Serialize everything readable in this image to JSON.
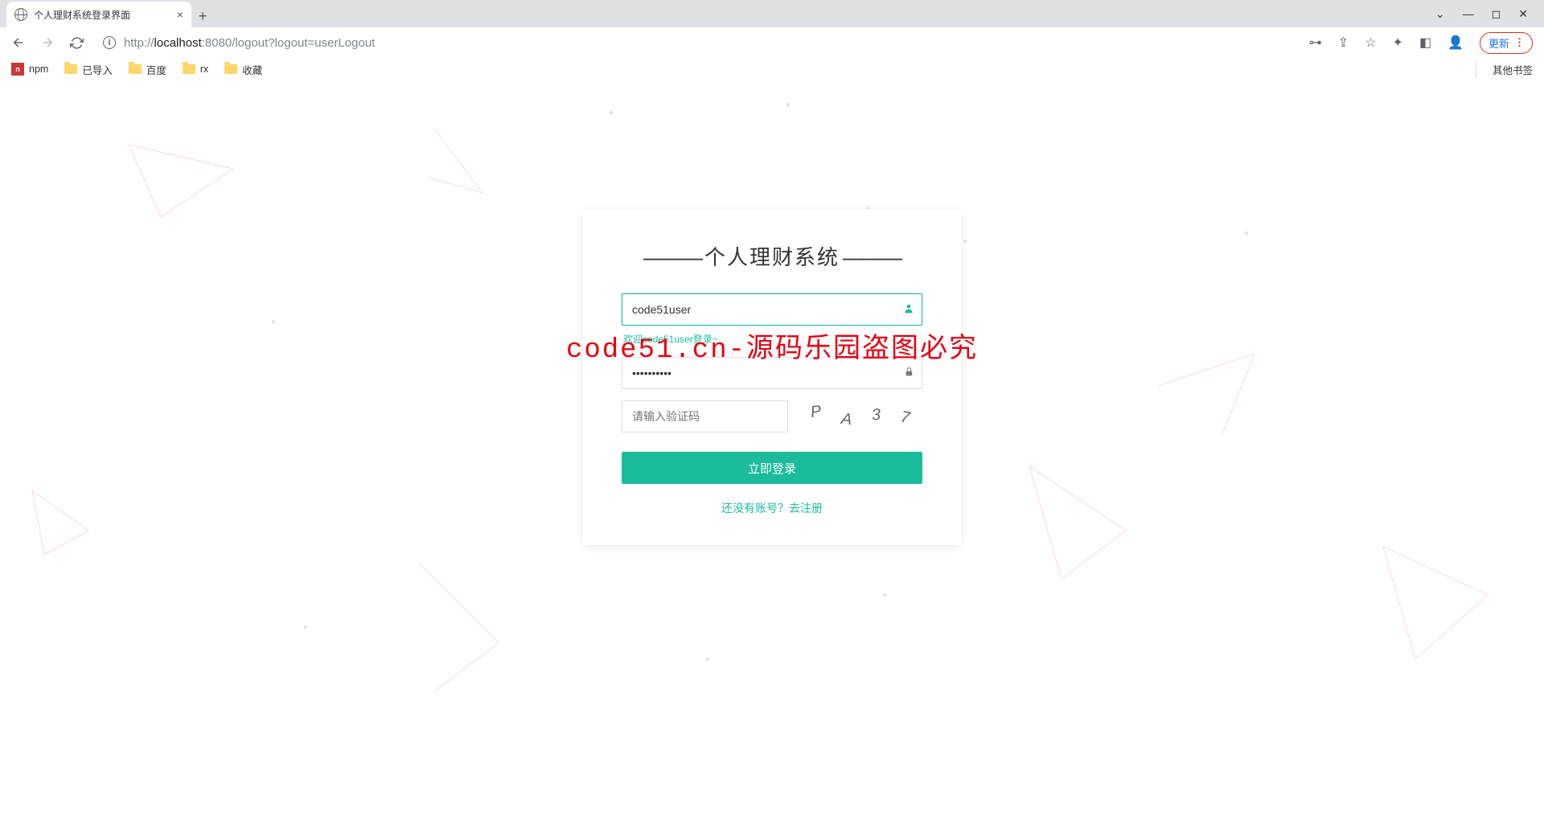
{
  "browser": {
    "tab_title": "个人理财系统登录界面",
    "url_prefix": "http://",
    "url_host": "localhost",
    "url_port": ":8080",
    "url_path": "/logout?logout=userLogout",
    "update_label": "更新",
    "bookmarks": {
      "npm": "npm",
      "imported": "已导入",
      "baidu": "百度",
      "rx": "rx",
      "favorites": "收藏",
      "other": "其他书签"
    }
  },
  "login": {
    "title": "个人理财系统",
    "username_value": "code51user",
    "username_hint": "欢迎code51user登录~",
    "password_value": "••••••••••",
    "captcha_placeholder": "请输入验证码",
    "captcha_text": "PA37",
    "submit_label": "立即登录",
    "register_link": "还没有账号？去注册"
  },
  "watermark": "code51.cn-源码乐园盗图必究"
}
